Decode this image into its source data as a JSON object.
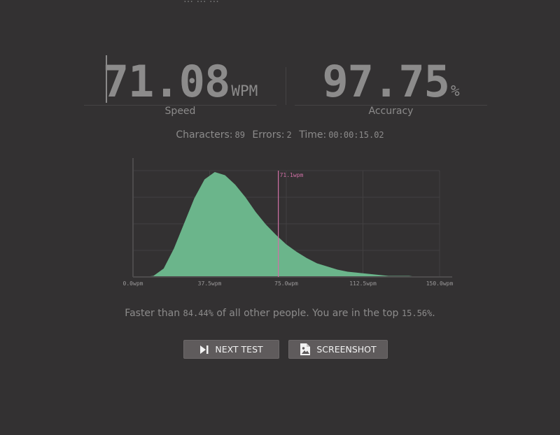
{
  "top_line": "… … …",
  "speed": {
    "value": "71.08",
    "unit": "WPM",
    "label": "Speed"
  },
  "accuracy": {
    "value": "97.75",
    "unit": "%",
    "label": "Accuracy"
  },
  "summary": {
    "characters_label": "Characters:",
    "characters_value": "89",
    "errors_label": "Errors:",
    "errors_value": "2",
    "time_label": "Time:",
    "time_value": "00:00:15.02"
  },
  "percentile": {
    "prefix": "Faster than",
    "faster_value": "84.44%",
    "middle": "of all other people. You are in the top",
    "top_value": "15.56%",
    "suffix": "."
  },
  "buttons": {
    "next_test": "NEXT TEST",
    "screenshot": "SCREENSHOT"
  },
  "colors": {
    "background": "#333132",
    "text": "#8c8b8b",
    "histogram_fill": "#6bb58b",
    "marker": "#d070a6",
    "button_bg": "#5f5b5c"
  },
  "chart_data": {
    "type": "area",
    "xlim": [
      0,
      150
    ],
    "ylim": [
      0,
      1
    ],
    "xticks": [
      0,
      37.5,
      75,
      112.5,
      150
    ],
    "xtick_labels": [
      "0.0wpm",
      "37.5wpm",
      "75.0wpm",
      "112.5wpm",
      "150.0wpm"
    ],
    "grid": true,
    "series": [
      {
        "x": [
          5,
          10,
          15,
          20,
          25,
          30,
          35,
          40,
          45,
          50,
          55,
          60,
          65,
          70,
          75,
          80,
          85,
          90,
          95,
          100,
          105,
          110,
          115,
          120,
          125,
          130,
          135,
          140,
          145
        ],
        "y": [
          0,
          0.01,
          0.08,
          0.27,
          0.51,
          0.75,
          0.93,
          1.0,
          0.97,
          0.88,
          0.76,
          0.62,
          0.5,
          0.4,
          0.31,
          0.24,
          0.18,
          0.13,
          0.1,
          0.07,
          0.05,
          0.04,
          0.03,
          0.02,
          0.01,
          0.01,
          0.01,
          0.0,
          0.0
        ]
      }
    ],
    "marker": {
      "x": 71.1,
      "label": "71.1wpm"
    }
  }
}
